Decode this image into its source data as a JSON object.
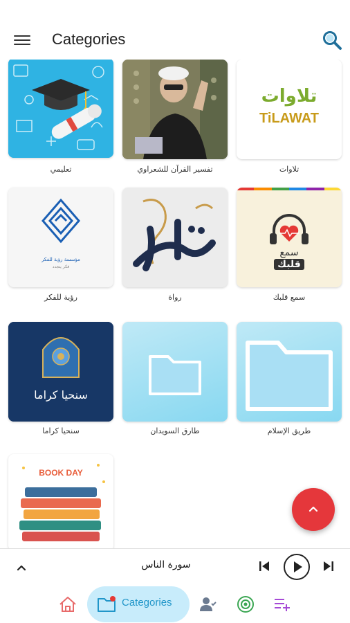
{
  "header": {
    "title": "Categories"
  },
  "categories": [
    {
      "label": "تعليمي"
    },
    {
      "label": "تفسير القرآن للشعراوي"
    },
    {
      "label": "تلاوات",
      "logo_ar": "تلاوات",
      "logo_en": "TiLAWAT"
    },
    {
      "label": "رؤية للفكر",
      "logo_text": "مؤسسة رؤية للفكر",
      "logo_sub": "فكر يتجدد"
    },
    {
      "label": "رواة"
    },
    {
      "label": "سمع قلبك",
      "logo_line1": "سمع",
      "logo_line2": "قلبك"
    },
    {
      "label": "سنحيا كراما",
      "logo_text": "سنحيا كراما"
    },
    {
      "label": "طارق السويدان"
    },
    {
      "label": "طريق الإسلام"
    },
    {
      "label": "",
      "banner": "BOOK DAY"
    }
  ],
  "player": {
    "track": "سورة الناس"
  },
  "bottom_nav": {
    "active_label": "Categories"
  },
  "colors": {
    "accent": "#2196c9",
    "fab": "#e5373b",
    "pill": "#c8ecfb",
    "folder_bg": "#a9dff4"
  }
}
